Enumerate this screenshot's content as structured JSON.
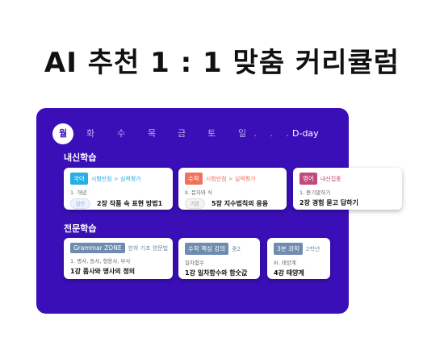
{
  "headline": "AI 추천 1 : 1 맞춤 커리큘럼",
  "days": [
    "월",
    "화",
    "수",
    "목",
    "금",
    "토",
    "일",
    ".",
    ".",
    "."
  ],
  "dday": "D-day",
  "sections": {
    "school": "내신학습",
    "special": "전문학습"
  },
  "colors": {
    "panel": "#3a0fb8",
    "korean": "#27aee3",
    "math": "#f2715c",
    "english": "#c2497f",
    "special": "#6f8bb0"
  },
  "school_cards": [
    {
      "tag": "국어",
      "crumb": "시험만점 > 심력평가",
      "sub": "1. 개념",
      "pill": "발전",
      "lesson": "2장 작품 속 표현 방법1"
    },
    {
      "tag": "수학",
      "crumb": "시험만점 > 실력평가",
      "sub": "II. 문자와 식",
      "pill": "기본",
      "lesson": "5장 지수법칙의 응용"
    },
    {
      "tag": "영어",
      "crumb": "내신집중",
      "sub": "1. 듣기말하기",
      "lesson": "2장 경험 묻고 답하기"
    }
  ],
  "special_cards": [
    {
      "tag": "Grammar ZONE",
      "crumb": "한하 기초 영문법",
      "sub": "1. 명사, 동사, 형용사, 부사",
      "lesson": "1강 품사와 명사의 정의"
    },
    {
      "tag": "수학 핵심 강의",
      "crumb": "중2",
      "sub": "일차함수",
      "lesson": "1강 일차함수와 함숫값"
    },
    {
      "tag": "3분 과학",
      "crumb": "2학년",
      "sub": "III. 태양계",
      "lesson": "4강 태양계"
    }
  ]
}
